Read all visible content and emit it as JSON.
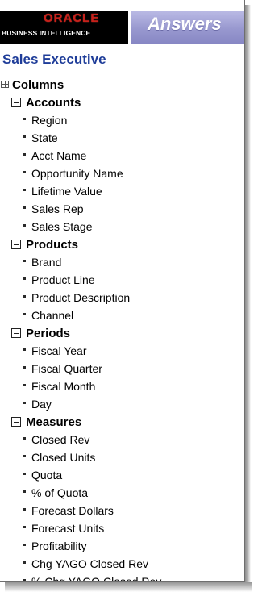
{
  "header": {
    "logo_oracle": "ORACLE",
    "logo_bi": "BUSINESS INTELLIGENCE",
    "title": "Answers"
  },
  "subject_area": "Sales Executive",
  "tree": {
    "root_label": "Columns",
    "folders": [
      {
        "label": "Accounts",
        "columns": [
          "Region",
          "State",
          "Acct Name",
          "Opportunity Name",
          "Lifetime Value",
          "Sales Rep",
          "Sales Stage"
        ]
      },
      {
        "label": "Products",
        "columns": [
          "Brand",
          "Product Line",
          "Product Description",
          "Channel"
        ]
      },
      {
        "label": "Periods",
        "columns": [
          "Fiscal Year",
          "Fiscal Quarter",
          "Fiscal Month",
          "Day"
        ]
      },
      {
        "label": "Measures",
        "columns": [
          "Closed Rev",
          "Closed Units",
          "Quota",
          "% of Quota",
          "Forecast Dollars",
          "Forecast Units",
          "Profitability",
          "Chg YAGO Closed Rev",
          "% Chg YAGO Closed Rev"
        ]
      }
    ]
  },
  "colors": {
    "subject_blue": "#1f3d99",
    "oracle_red": "#c8201a",
    "answers_banner": "#9898cf"
  }
}
